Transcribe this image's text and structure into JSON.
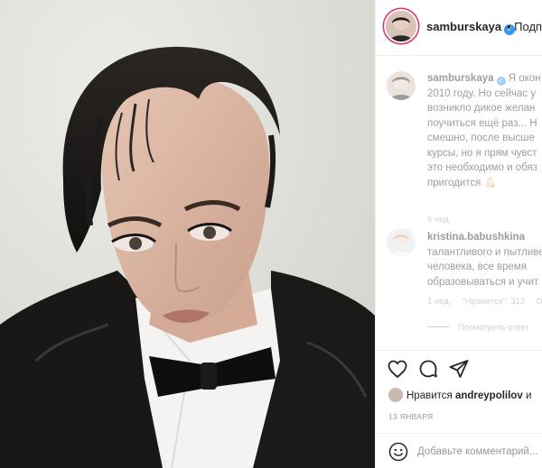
{
  "post": {
    "username": "samburskaya",
    "follow_label": "• Подп",
    "verified_icon": "verified-badge-icon"
  },
  "comments": [
    {
      "username": "samburskaya",
      "text": "Я окон\n2010 году. Но сейчас у\nвозникло дикое желан\nпоучиться ещё раз... Н\nсмешно, после высше\nкурсы, но я прям чувст\nэто необходимо и обяз\nпригодится 💪🏻",
      "time": "6 нед."
    },
    {
      "username": "kristina.babushkina",
      "text": "\nталантливого и пытливе\nчеловека, все время\nобразовываться и учит",
      "time": "1 нед.",
      "likes_label": "\"Нравится\": 312",
      "reply_label": "О",
      "view_replies": "Посмотреть ответ"
    }
  ],
  "likes": {
    "prefix": "Нравится",
    "user": "andreypolilov",
    "suffix": "и"
  },
  "date": "13 ЯНВАРЯ",
  "add_comment": {
    "placeholder": "Добавьте комментарий..."
  },
  "colors": {
    "text": "#262626",
    "muted": "#999999",
    "verified": "#3897f0",
    "story_ring": "#dc2f6f",
    "border": "#efefef"
  },
  "icons": [
    "heart-icon",
    "comment-icon",
    "share-icon",
    "smiley-icon",
    "more-icon"
  ]
}
